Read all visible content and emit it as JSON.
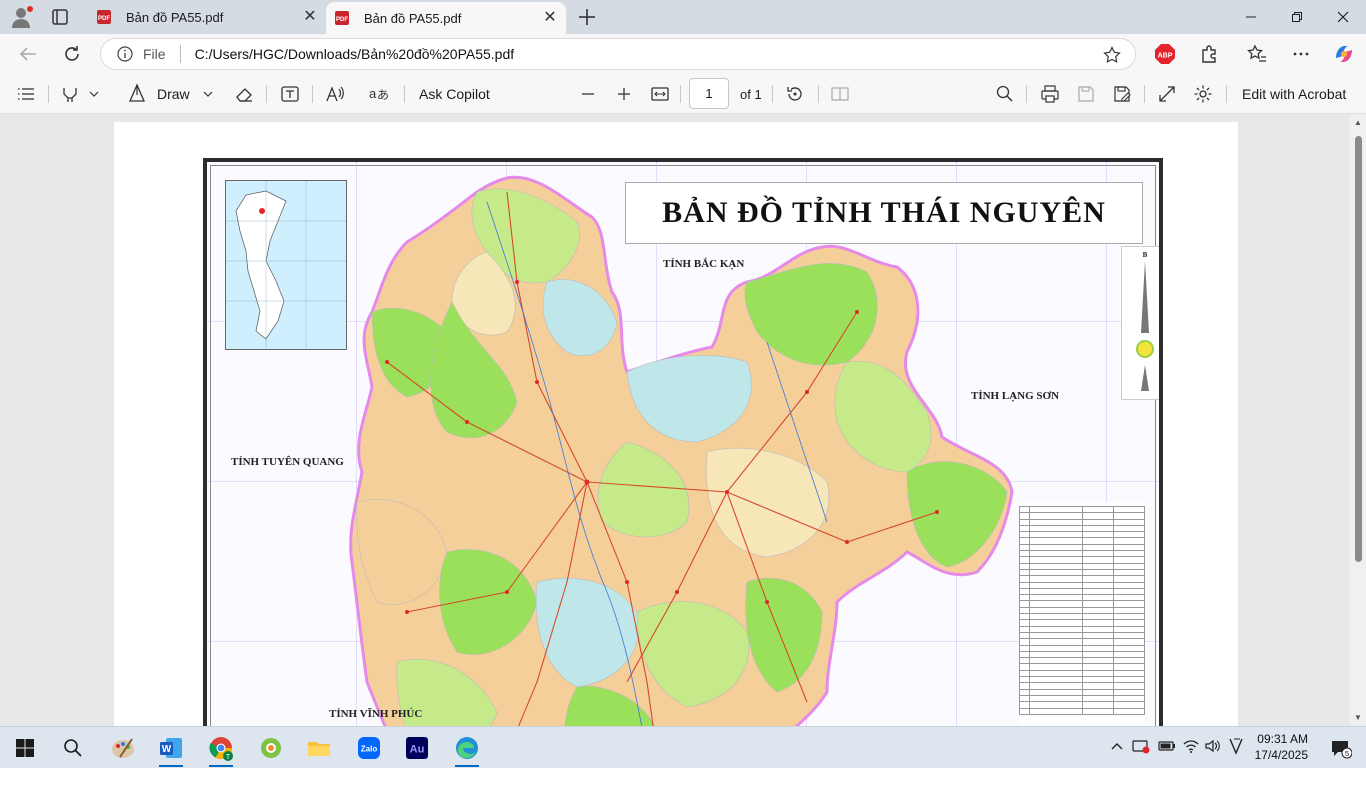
{
  "browser": {
    "tabs": [
      {
        "title": "Bản đồ PA55.pdf",
        "active": false
      },
      {
        "title": "Bản đồ PA55.pdf",
        "active": true
      }
    ],
    "address": {
      "scheme_label": "File",
      "url": "C:/Users/HGC/Downloads/Bản%20đồ%20PA55.pdf"
    },
    "extensions": {
      "abp": "ABP"
    }
  },
  "pdf_toolbar": {
    "draw_label": "Draw",
    "copilot_label": "Ask Copilot",
    "page_current": "1",
    "page_total": "of 1",
    "acrobat_label": "Edit with Acrobat"
  },
  "map": {
    "title": "BẢN ĐỒ TỈNH THÁI NGUYÊN",
    "neighbors": {
      "north": "TỈNH BẮC KẠN",
      "east": "TỈNH LẠNG SƠN",
      "west": "TỈNH TUYÊN QUANG",
      "southwest": "TỈNH VĨNH PHÚC"
    },
    "compass_letter": "B"
  },
  "taskbar": {
    "apps": [
      "paint-icon",
      "word-icon",
      "chrome-icon",
      "game-icon",
      "explorer-icon",
      "zalo-icon",
      "audition-icon",
      "edge-icon"
    ],
    "zalo_label": "Zalo",
    "au_label": "Au",
    "time": "09:31 AM",
    "date": "17/4/2025",
    "notif_count": "5"
  }
}
